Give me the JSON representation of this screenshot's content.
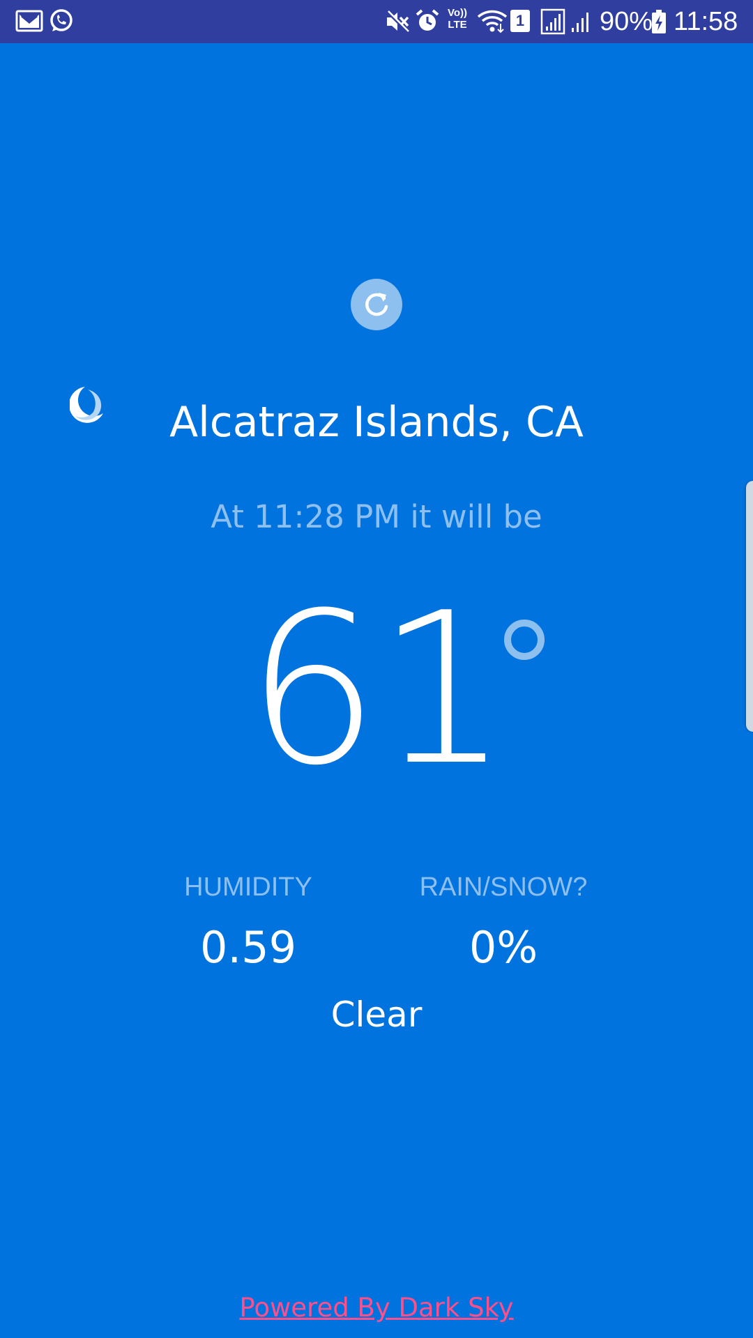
{
  "status_bar": {
    "battery_percent": "90%",
    "time": "11:58",
    "sim_slot": "1",
    "volte_top": "Vo))",
    "volte_bottom": "LTE",
    "icons": [
      "gmail-icon",
      "whatsapp-icon",
      "mute-icon",
      "alarm-icon",
      "volte-icon",
      "wifi-icon",
      "sim-icon",
      "signal-icon",
      "signal-icon",
      "battery-charging-icon"
    ]
  },
  "weather": {
    "location": "Alcatraz Islands, CA",
    "subtitle": "At 11:28 PM it will be",
    "temperature": "61",
    "condition_icon": "moon-icon",
    "humidity_label": "HUMIDITY",
    "humidity_value": "0.59",
    "precip_label": "RAIN/SNOW?",
    "precip_value": "0%",
    "summary": "Clear"
  },
  "footer": {
    "powered_by": "Powered By Dark Sky"
  },
  "colors": {
    "background": "#0073df",
    "status_bar": "#303e9f",
    "muted_text": "#8ec0ef",
    "link": "#ff4f8a"
  }
}
